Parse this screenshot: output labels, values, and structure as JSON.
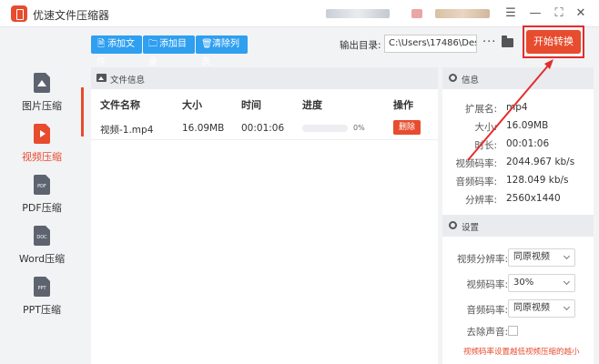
{
  "app": {
    "title": "优速文件压缩器"
  },
  "window": {
    "icons": [
      "menu-icon",
      "minimize-icon",
      "maximize-icon",
      "close-icon"
    ]
  },
  "sidebar": {
    "active_index": 1,
    "items": [
      {
        "label": "图片压缩",
        "icon": "image-file-icon",
        "badge": ""
      },
      {
        "label": "视频压缩",
        "icon": "video-file-icon",
        "badge": ""
      },
      {
        "label": "PDF压缩",
        "icon": "pdf-file-icon",
        "badge": "PDF"
      },
      {
        "label": "Word压缩",
        "icon": "doc-file-icon",
        "badge": "DOC"
      },
      {
        "label": "PPT压缩",
        "icon": "ppt-file-icon",
        "badge": "PPT"
      }
    ]
  },
  "toolbar": {
    "add_file": "添加文件",
    "add_dir": "添加目录",
    "clear_list": "清除列表",
    "output_label": "输出目录:",
    "output_path": "C:\\Users\\17486\\Deskto",
    "more": "···",
    "start": "开始转换"
  },
  "file_panel": {
    "title": "文件信息",
    "columns": {
      "name": "文件名称",
      "size": "大小",
      "time": "时间",
      "progress": "进度",
      "action": "操作"
    },
    "rows": [
      {
        "name": "视频-1.mp4",
        "size": "16.09MB",
        "time": "00:01:06",
        "progress": 0,
        "progress_text": "0%",
        "action": "删除"
      }
    ]
  },
  "info_panel": {
    "title": "信息",
    "fields": [
      {
        "key": "扩展名:",
        "value": "mp4"
      },
      {
        "key": "大小:",
        "value": "16.09MB"
      },
      {
        "key": "时长:",
        "value": "00:01:06"
      },
      {
        "key": "视频码率:",
        "value": "2044.967 kb/s"
      },
      {
        "key": "音频码率:",
        "value": "128.049 kb/s"
      },
      {
        "key": "分辨率:",
        "value": "2560x1440"
      }
    ]
  },
  "settings_panel": {
    "title": "设置",
    "video_resolution": {
      "label": "视频分辨率:",
      "value": "同原视频"
    },
    "video_bitrate": {
      "label": "视频码率:",
      "value": "30%"
    },
    "audio_bitrate": {
      "label": "音频码率:",
      "value": "同原视频"
    },
    "remove_audio": {
      "label": "去除声音:",
      "checked": false
    },
    "hint": "视频码率设置越低视频压缩的越小"
  },
  "colors": {
    "accent": "#e74c2e",
    "button_blue": "#2f9ff0",
    "annotation": "#e32d2d"
  }
}
